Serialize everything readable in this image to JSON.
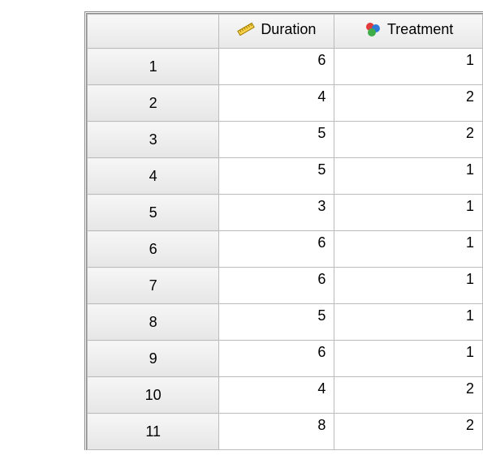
{
  "columns": {
    "c0": "",
    "c1": "Duration",
    "c2": "Treatment"
  },
  "rows": [
    {
      "idx": "1",
      "duration": "6",
      "treatment": "1"
    },
    {
      "idx": "2",
      "duration": "4",
      "treatment": "2"
    },
    {
      "idx": "3",
      "duration": "5",
      "treatment": "2"
    },
    {
      "idx": "4",
      "duration": "5",
      "treatment": "1"
    },
    {
      "idx": "5",
      "duration": "3",
      "treatment": "1"
    },
    {
      "idx": "6",
      "duration": "6",
      "treatment": "1"
    },
    {
      "idx": "7",
      "duration": "6",
      "treatment": "1"
    },
    {
      "idx": "8",
      "duration": "5",
      "treatment": "1"
    },
    {
      "idx": "9",
      "duration": "6",
      "treatment": "1"
    },
    {
      "idx": "10",
      "duration": "4",
      "treatment": "2"
    },
    {
      "idx": "11",
      "duration": "8",
      "treatment": "2"
    }
  ]
}
